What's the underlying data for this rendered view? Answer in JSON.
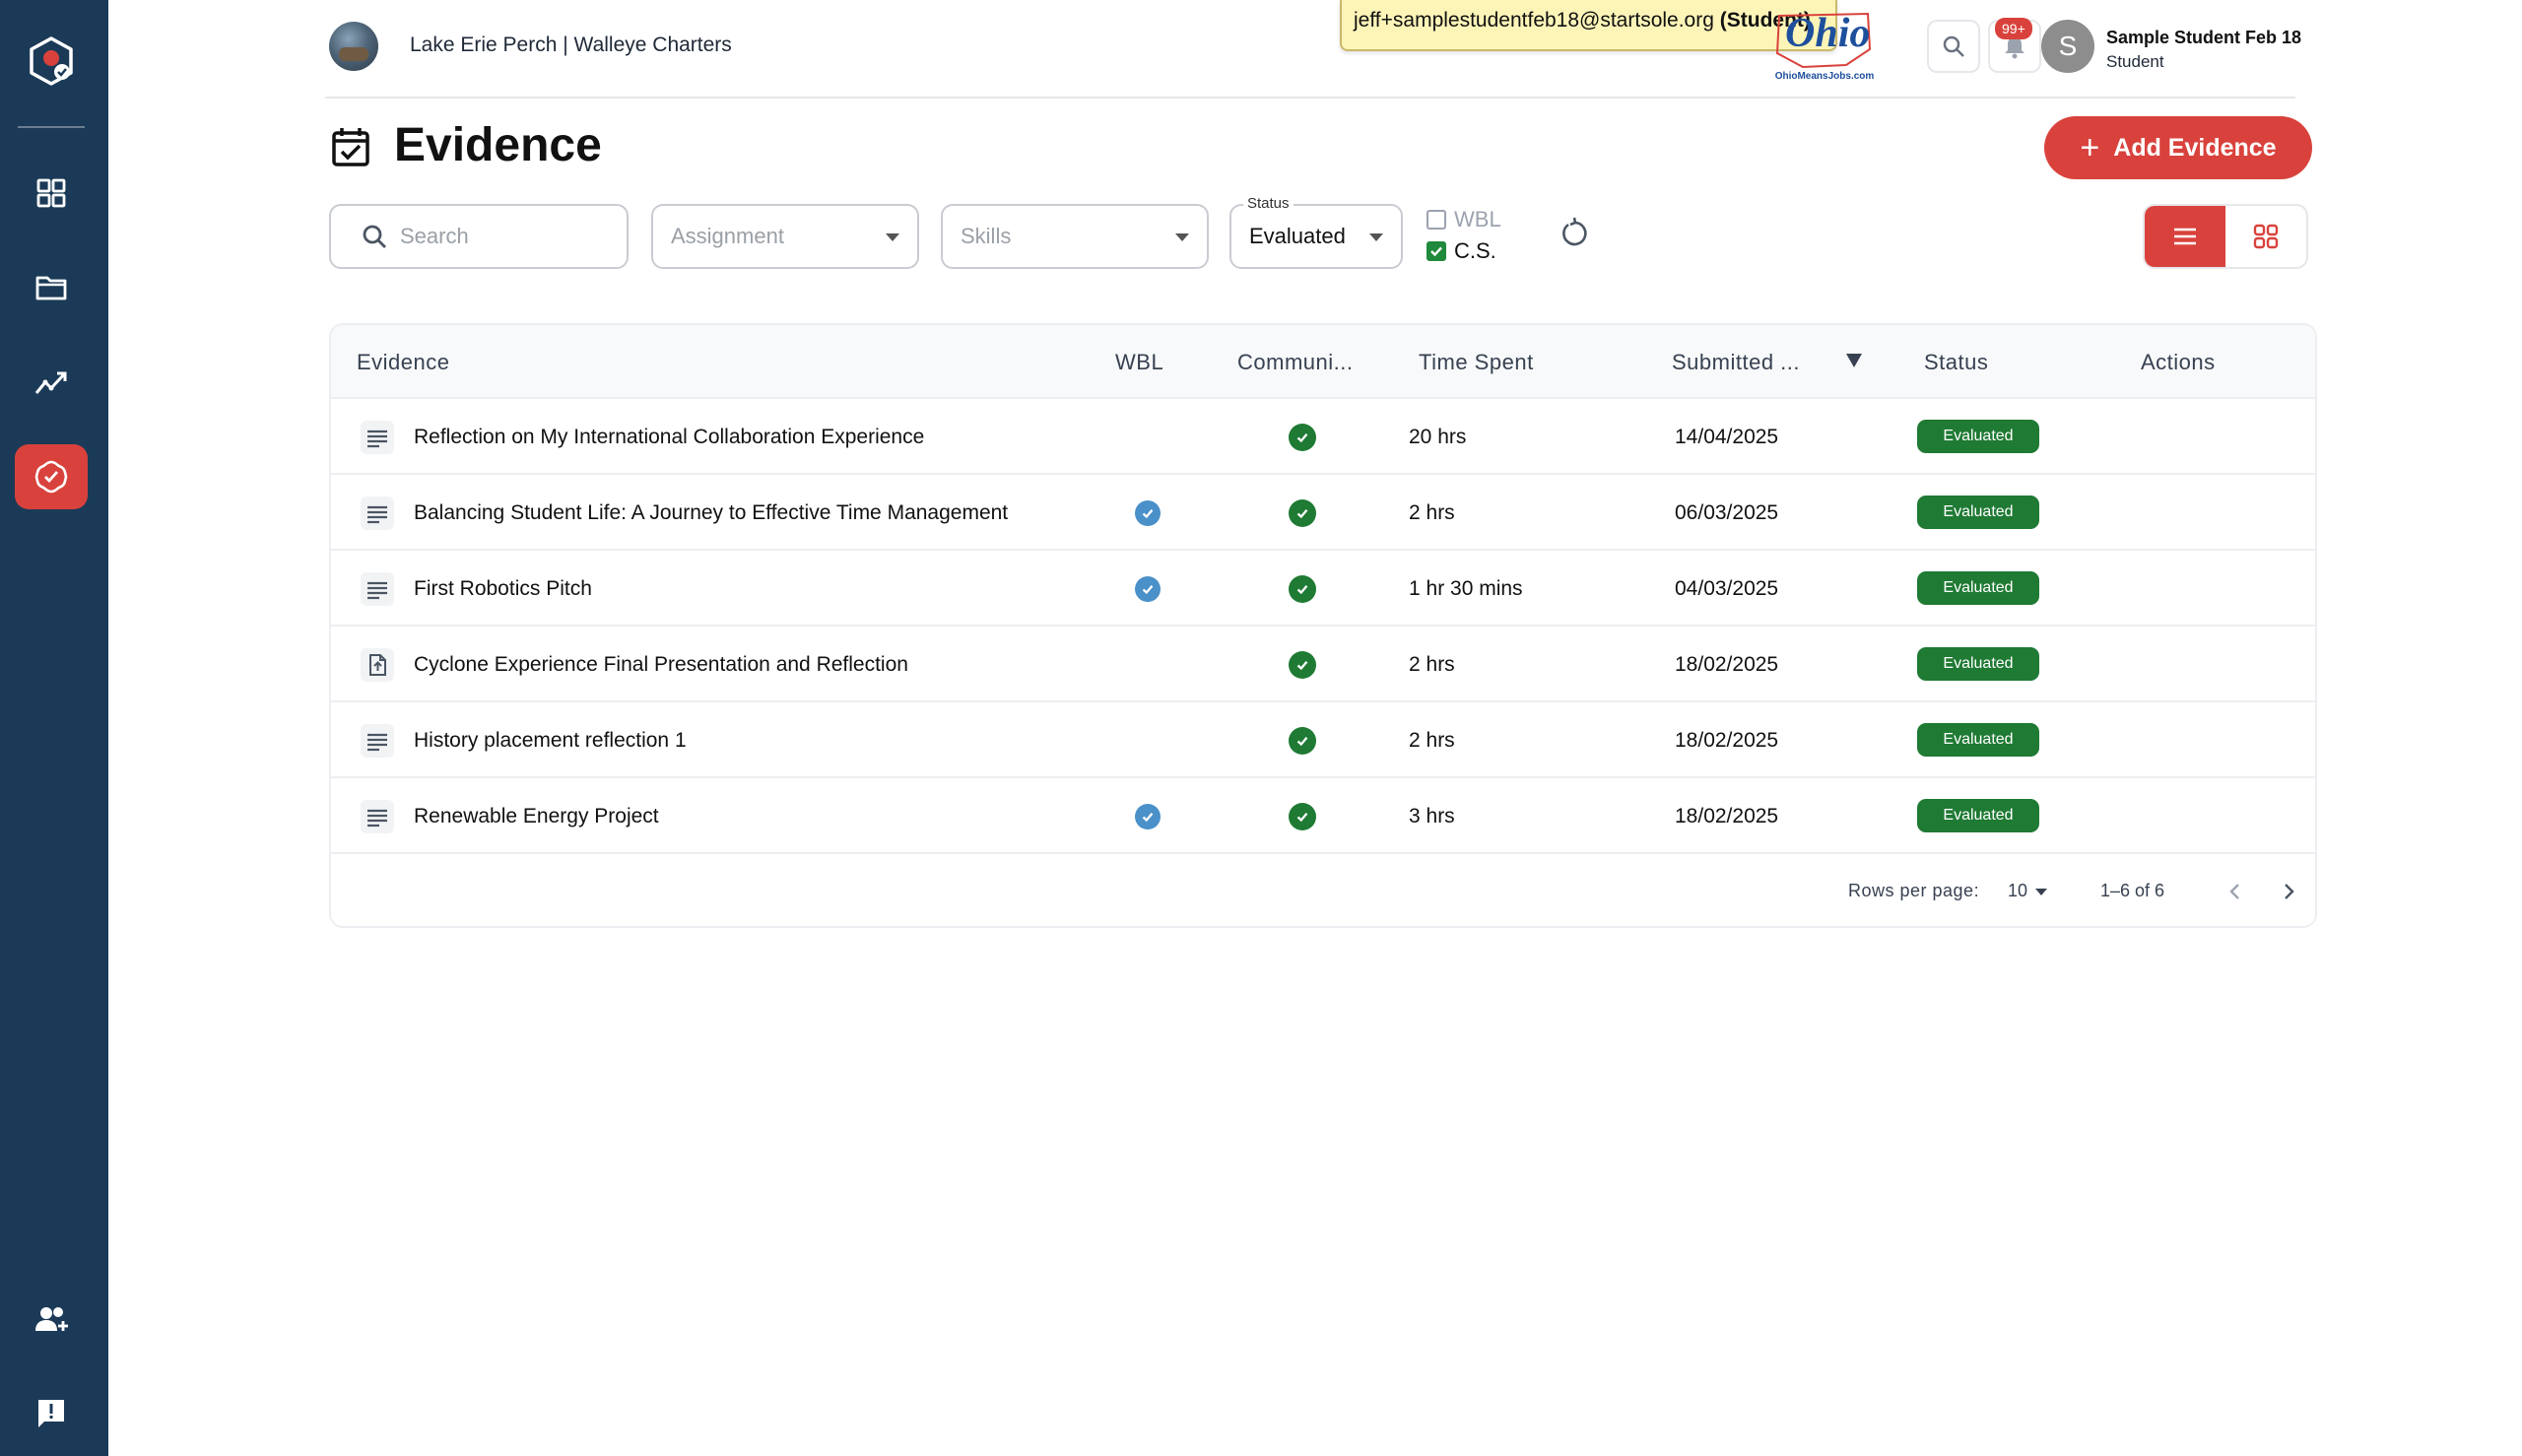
{
  "header": {
    "org_name": "Lake Erie Perch | Walleye Charters",
    "impersonation": {
      "email": "jeff+samplestudentfeb18@startsole.org",
      "role_tag": "(Student)"
    },
    "logo": {
      "word": "Ohio",
      "sub": "OhioMeansJobs.com"
    },
    "notifications_badge": "99+",
    "user": {
      "initial": "S",
      "name": "Sample Student Feb 18",
      "role": "Student"
    }
  },
  "sidebar": {
    "items": [
      {
        "name": "dashboard",
        "icon": "grid-icon"
      },
      {
        "name": "portfolio",
        "icon": "folder-icon"
      },
      {
        "name": "progress",
        "icon": "trending-up-icon"
      },
      {
        "name": "evidence",
        "icon": "badge-check-icon",
        "active": true
      }
    ],
    "bottom": [
      {
        "name": "invite",
        "icon": "add-user-icon"
      },
      {
        "name": "feedback",
        "icon": "feedback-icon"
      }
    ]
  },
  "page": {
    "title": "Evidence",
    "add_button": "Add Evidence"
  },
  "filters": {
    "search_placeholder": "Search",
    "assignment_placeholder": "Assignment",
    "skills_placeholder": "Skills",
    "status_label": "Status",
    "status_value": "Evaluated",
    "wbl_label": "WBL",
    "wbl_checked": false,
    "cs_label": "C.S.",
    "cs_checked": true
  },
  "table": {
    "columns": [
      "Evidence",
      "WBL",
      "Communi...",
      "Time Spent",
      "Submitted ...",
      "Status",
      "Actions"
    ],
    "rows": [
      {
        "icon": "text-lines-icon",
        "title": "Reflection on My International Collaboration Experience",
        "wbl": false,
        "cs": true,
        "time": "20 hrs",
        "date": "14/04/2025",
        "status": "Evaluated"
      },
      {
        "icon": "text-lines-icon",
        "title": "Balancing Student Life: A Journey to Effective Time Management",
        "wbl": true,
        "cs": true,
        "time": "2 hrs",
        "date": "06/03/2025",
        "status": "Evaluated"
      },
      {
        "icon": "text-lines-icon",
        "title": "First Robotics Pitch",
        "wbl": true,
        "cs": true,
        "time": "1 hr 30 mins",
        "date": "04/03/2025",
        "status": "Evaluated"
      },
      {
        "icon": "file-upload-icon",
        "title": "Cyclone Experience Final Presentation and Reflection",
        "wbl": false,
        "cs": true,
        "time": "2 hrs",
        "date": "18/02/2025",
        "status": "Evaluated"
      },
      {
        "icon": "text-lines-icon",
        "title": "History placement reflection 1",
        "wbl": false,
        "cs": true,
        "time": "2 hrs",
        "date": "18/02/2025",
        "status": "Evaluated"
      },
      {
        "icon": "text-lines-icon",
        "title": "Renewable Energy Project",
        "wbl": true,
        "cs": true,
        "time": "3 hrs",
        "date": "18/02/2025",
        "status": "Evaluated"
      }
    ],
    "footer": {
      "rows_per_page_label": "Rows per page:",
      "rows_per_page": "10",
      "range": "1–6 of 6"
    }
  },
  "colors": {
    "sidebar_bg": "#1b3a57",
    "accent": "#d9423c",
    "status_green": "#1f7a34",
    "wbl_blue": "#4a90c9"
  }
}
